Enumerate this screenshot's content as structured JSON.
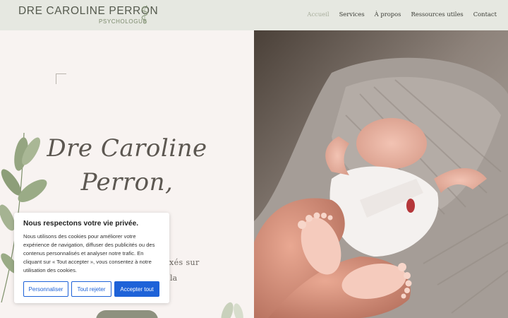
{
  "header": {
    "logo_name": "DRE CAROLINE PERRON",
    "logo_subtitle": "PSYCHOLOGUE",
    "nav": [
      {
        "label": "Accueil",
        "active": true
      },
      {
        "label": "Services",
        "active": false
      },
      {
        "label": "À propos",
        "active": false
      },
      {
        "label": "Ressources utiles",
        "active": false
      },
      {
        "label": "Contact",
        "active": false
      }
    ]
  },
  "hero": {
    "title_line1": "Dre Caroline",
    "title_line2": "Perron,",
    "text_line1": "xés sur",
    "text_line2": "la",
    "photo_description": "newborn-feet-held-in-parent-hands"
  },
  "cookie_banner": {
    "title": "Nous respectons votre vie privée.",
    "text": "Nous utilisons des cookies pour améliorer votre expérience de navigation, diffuser des publicités ou des contenus personnalisés et analyser notre trafic. En cliquant sur « Tout accepter », vous consentez à notre utilisation des cookies.",
    "btn_customize": "Personnaliser",
    "btn_reject": "Tout rejeter",
    "btn_accept": "Accepter tout"
  },
  "colors": {
    "header_bg": "#e6e8e1",
    "page_bg": "#f8f3f1",
    "accent_sage": "#8e917f",
    "cookie_blue": "#1e62d8"
  }
}
